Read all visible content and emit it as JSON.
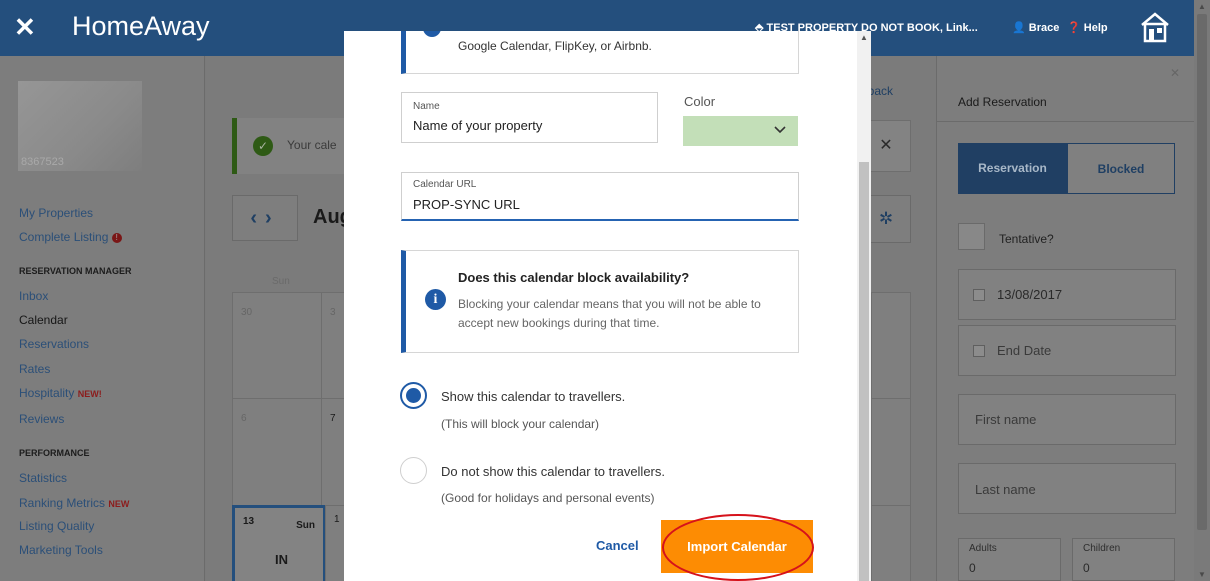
{
  "header": {
    "brand": "HomeAway",
    "property_link": "TEST PROPERTY DO NOT BOOK, Link...",
    "user": "Brace",
    "help": "Help"
  },
  "sidebar": {
    "property_id": "8367523",
    "links_top": [
      "My Properties",
      "Complete Listing"
    ],
    "section1": "RESERVATION MANAGER",
    "section1_items": [
      "Inbox",
      "Calendar",
      "Reservations",
      "Rates",
      "Hospitality",
      "Reviews"
    ],
    "hospitality_badge": "NEW!",
    "section2": "PERFORMANCE",
    "section2_items": [
      "Statistics",
      "Ranking Metrics",
      "Listing Quality",
      "Marketing Tools"
    ],
    "ranking_badge": "NEW"
  },
  "main": {
    "success_text": "Your cale",
    "feedback": "dback",
    "month": "Aug",
    "weekday_label": "Sun",
    "cells": [
      "30",
      "3",
      "6",
      "7",
      "13",
      "1"
    ],
    "today_weekday": "Sun",
    "today_status": "IN"
  },
  "right_panel": {
    "title": "Add Reservation",
    "tab_reservation": "Reservation",
    "tab_blocked": "Blocked",
    "tentative": "Tentative?",
    "start_date": "13/08/2017",
    "end_date": "End Date",
    "first_name": "First name",
    "last_name": "Last name",
    "adults_label": "Adults",
    "adults_value": "0",
    "children_label": "Children",
    "children_value": "0"
  },
  "modal": {
    "top_info_text": "Google Calendar, FlipKey, or Airbnb.",
    "name_label": "Name",
    "name_value": "Name of your property",
    "color_label": "Color",
    "color_value": "#c3dfb8",
    "url_label": "Calendar URL",
    "url_value": "PROP-SYNC URL",
    "block_heading": "Does this calendar block availability?",
    "block_body": "Blocking your calendar means that you will not be able to accept new bookings during that time.",
    "option_show": "Show this calendar to travellers.",
    "option_show_sub": "(This will block your calendar)",
    "option_hide": "Do not show this calendar to travellers.",
    "option_hide_sub": "(Good for holidays and personal events)",
    "cancel": "Cancel",
    "import": "Import Calendar"
  },
  "colors": {
    "brand_blue": "#244f7d",
    "accent_blue": "#1f5aa6",
    "import_orange": "#fd8c03",
    "annotation_red": "#d6121b",
    "color_swatch": "#c3dfb8"
  }
}
